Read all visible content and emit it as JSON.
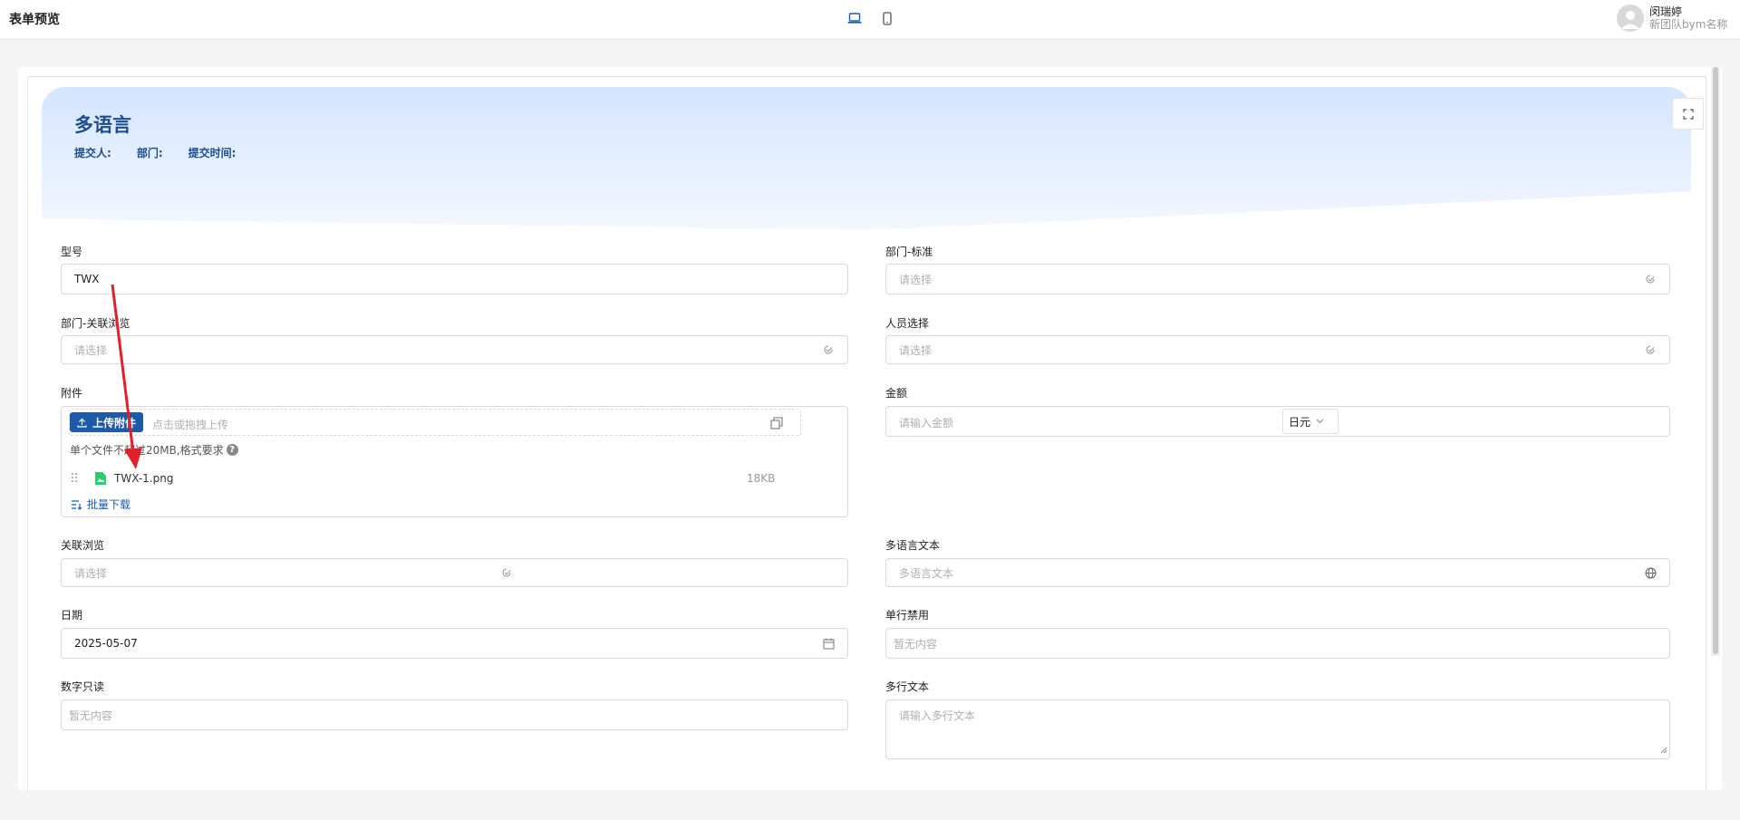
{
  "header": {
    "title": "表单预览",
    "user_name": "闵瑞婷",
    "team_name": "新团队bym名称"
  },
  "banner": {
    "title": "多语言",
    "submitter_label": "提交人:",
    "department_label": "部门:",
    "submit_time_label": "提交时间:"
  },
  "fields": {
    "model": {
      "label": "型号",
      "value": "TWX"
    },
    "dept_standard": {
      "label": "部门-标准",
      "placeholder": "请选择"
    },
    "dept_link": {
      "label": "部门-关联浏览",
      "placeholder": "请选择"
    },
    "person": {
      "label": "人员选择",
      "placeholder": "请选择"
    },
    "attachment": {
      "label": "附件",
      "upload_label": "上传附件",
      "upload_hint": "点击或拖拽上传",
      "note": "单个文件不超过20MB,格式要求",
      "help": "?",
      "file_name": "TWX-1.png",
      "file_size": "18KB",
      "batch_download": "批量下载"
    },
    "amount": {
      "label": "金额",
      "placeholder": "请输入金额",
      "currency": "日元"
    },
    "link_browse": {
      "label": "关联浏览",
      "placeholder": "请选择"
    },
    "ml_text": {
      "label": "多语言文本",
      "placeholder": "多语言文本"
    },
    "date": {
      "label": "日期",
      "value": "2025-05-07"
    },
    "single_disabled": {
      "label": "单行禁用",
      "value": "暂无内容"
    },
    "number_readonly": {
      "label": "数字只读",
      "value": "暂无内容"
    },
    "multiline": {
      "label": "多行文本",
      "placeholder": "请输入多行文本"
    }
  },
  "colors": {
    "accent": "#1d5aa8",
    "banner_title": "#1d4d8c",
    "annotation_arrow": "#e0202a",
    "file_icon": "#2ecc71"
  },
  "icons": {
    "device_desktop": "laptop-icon",
    "device_mobile": "mobile-icon",
    "fullscreen": "expand-icon",
    "select": "select-check-icon",
    "calendar": "calendar-icon",
    "globe": "globe-icon"
  }
}
